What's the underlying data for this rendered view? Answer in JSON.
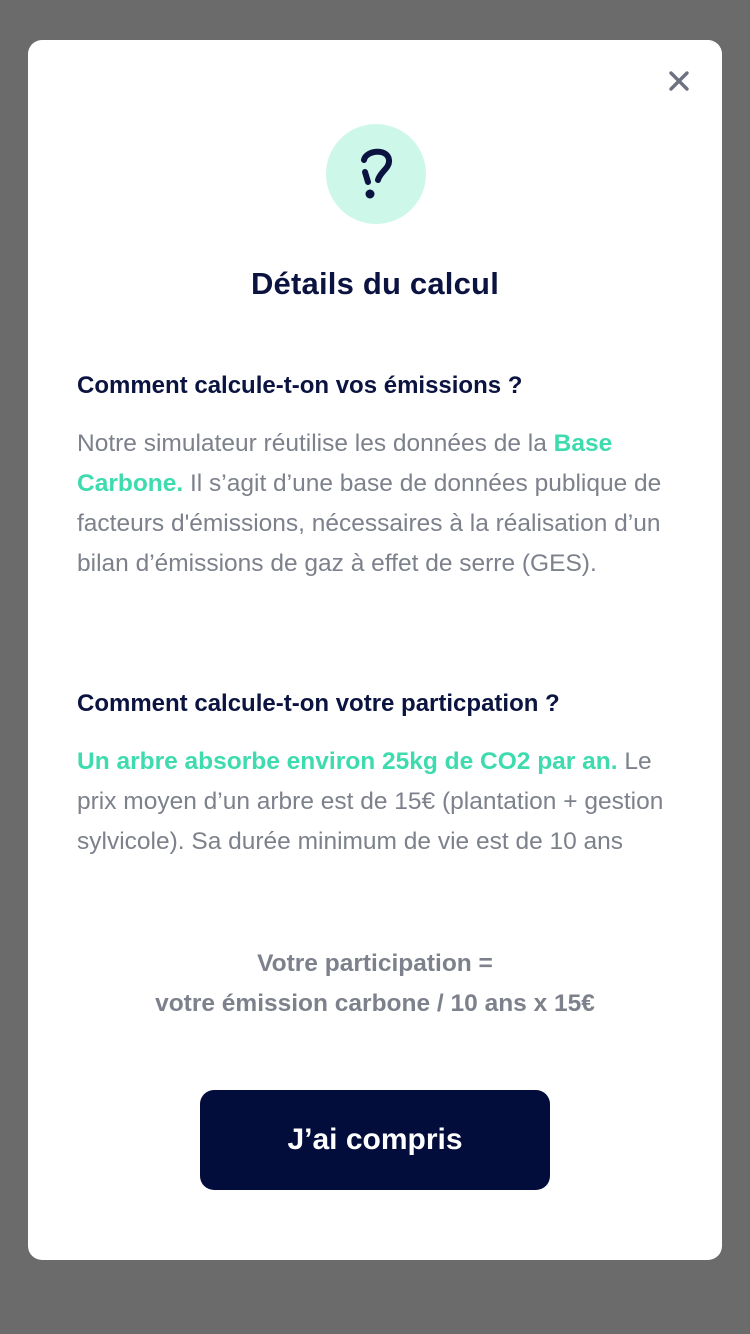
{
  "modal": {
    "close_icon": "close-icon",
    "header_icon": "question-mark-icon",
    "accent_color": "#3ddbae",
    "title": "Détails du calcul"
  },
  "emissions_section": {
    "heading": "Comment calcule-t-on vos émissions ?",
    "text_before": "Notre simulateur réutilise les données de la ",
    "link_text": "Base Carbone.",
    "text_after": " Il s’agit d’une base de données publique de facteurs d'émissions, nécessaires à la réalisation d’un bilan d’émissions de gaz à effet de serre (GES)."
  },
  "participation_section": {
    "heading": "Comment calcule-t-on votre particpation ?",
    "highlight": "Un arbre absorbe environ 25kg de CO2 par an.",
    "text": " Le prix moyen d’un arbre est de 15€ (plantation + gestion sylvicole). Sa durée minimum de vie est de 10 ans"
  },
  "formula": {
    "line1": "Votre participation =",
    "line2": "votre émission carbone / 10 ans x 15€"
  },
  "confirm_button": {
    "label": "J’ai compris"
  }
}
